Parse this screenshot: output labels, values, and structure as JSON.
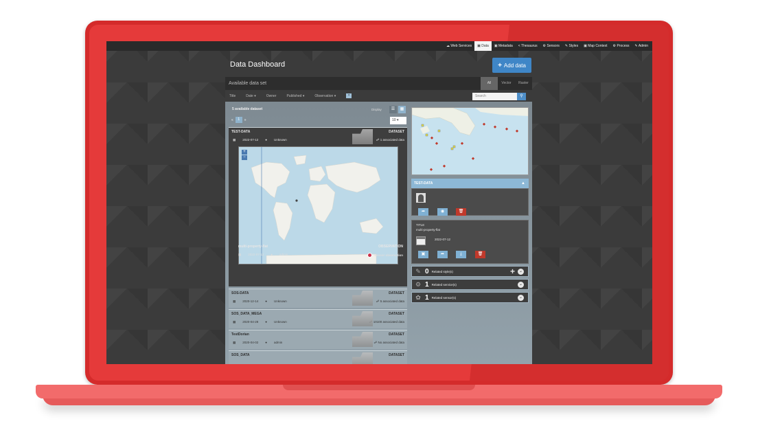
{
  "topnav": {
    "items": [
      "Web Services",
      "Data",
      "Metadata",
      "Thesaurus",
      "Sensors",
      "Styles",
      "Map Context",
      "Process",
      "Admin"
    ],
    "active": "Data"
  },
  "page": {
    "title": "Data Dashboard",
    "add_button": "Add data"
  },
  "panel": {
    "title": "Available data set",
    "tabs": [
      "All",
      "Vector",
      "Raster"
    ],
    "filters": [
      "Title",
      "Date",
      "Owner",
      "Published",
      "Observation"
    ],
    "search_placeholder": "Search",
    "count_text": "5 available dataset",
    "display_label": "Display",
    "page_number": "1",
    "per_page": "10"
  },
  "datasets": [
    {
      "name": "TEST-DATA",
      "type": "DATASET",
      "date": "2022-07-12",
      "owner": "Unknown",
      "assoc": "1 associated data"
    },
    {
      "name": "SOS-DATA",
      "type": "DATASET",
      "date": "2020-12-14",
      "owner": "Unknown",
      "assoc": "5 associated data"
    },
    {
      "name": "SOS_DATA_MEGA",
      "type": "DATASET",
      "date": "2020-04-28",
      "owner": "Unknown",
      "assoc": "10100 associated data"
    },
    {
      "name": "TestDorian",
      "type": "DATASET",
      "date": "2020-04-02",
      "owner": "admin",
      "assoc": "No associated data"
    },
    {
      "name": "SOS_DATA",
      "type": "DATASET",
      "date": "",
      "owner": "",
      "assoc": ""
    }
  ],
  "observation": {
    "name": "multi-property-flat",
    "type": "OBSERVATION",
    "date": "2022-07-12",
    "owner": "admin",
    "sensor": "Sensor observation"
  },
  "details": {
    "dataset_header": "TEST-DATA",
    "meta_label": "TITLE",
    "meta_value": "multi-property-flat",
    "meta_date": "2022-07-12",
    "related": [
      {
        "count": "0",
        "label": "Related style(s)",
        "icon": "brush-icon"
      },
      {
        "count": "1",
        "label": "Related service(s)",
        "icon": "services-icon"
      },
      {
        "count": "1",
        "label": "Related sensor(s)",
        "icon": "sensor-icon"
      }
    ]
  },
  "colors": {
    "frame": "#d42b2b",
    "accent": "#3f86c7",
    "delete": "#c0392b"
  }
}
